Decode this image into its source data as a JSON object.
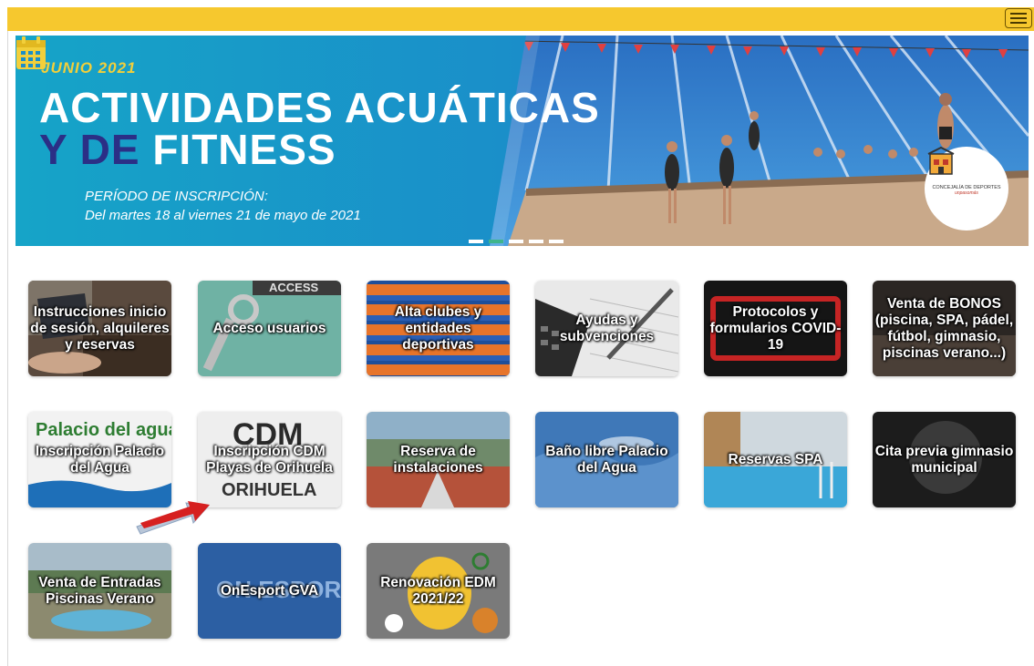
{
  "header": {
    "menu_icon": "hamburger-menu-icon",
    "accent": "#f6c82e"
  },
  "banner": {
    "month": "JUNIO 2021",
    "title_line1": "ACTIVIDADES ACUÁTICAS",
    "title_line2_dark": "Y DE",
    "title_line2_light": "FITNESS",
    "period_label": "PERÍODO DE INSCRIPCIÓN:",
    "period_dates": "Del martes 18 al viernes 21 de mayo de 2021",
    "logo_text": "CONCEJALÍA DE DEPORTES",
    "logo_sub": "unpasomás",
    "slide_count": 5,
    "active_slide": 2
  },
  "tiles": [
    {
      "label": "Instrucciones inicio de sesión, alquileres y reservas"
    },
    {
      "label": "Acceso usuarios"
    },
    {
      "label": "Alta clubes y entidades deportivas"
    },
    {
      "label": "Ayudas y subvenciones"
    },
    {
      "label": "Protocolos y formularios COVID-19"
    },
    {
      "label": "Venta de BONOS (piscina, SPA, pádel, fútbol, gimnasio, piscinas verano...)"
    },
    {
      "label": "Inscripción Palacio del Agua"
    },
    {
      "label": "Inscripción CDM Playas de Orihuela"
    },
    {
      "label": "Reserva de instalaciones"
    },
    {
      "label": "Baño libre Palacio del Agua"
    },
    {
      "label": "Reservas SPA"
    },
    {
      "label": "Cita previa gimnasio municipal"
    },
    {
      "label": "Venta de Entradas Piscinas Verano"
    },
    {
      "label": "OnEsport GVA"
    },
    {
      "label": "Renovación EDM 2021/22"
    }
  ],
  "tile_images": {
    "img_access": "ACCESS",
    "img_palacio": "Palacio del agua",
    "img_cdm_top": "CDM",
    "img_cdm_bottom": "ORIHUELA",
    "img_onesport": "ON ESPORT"
  }
}
